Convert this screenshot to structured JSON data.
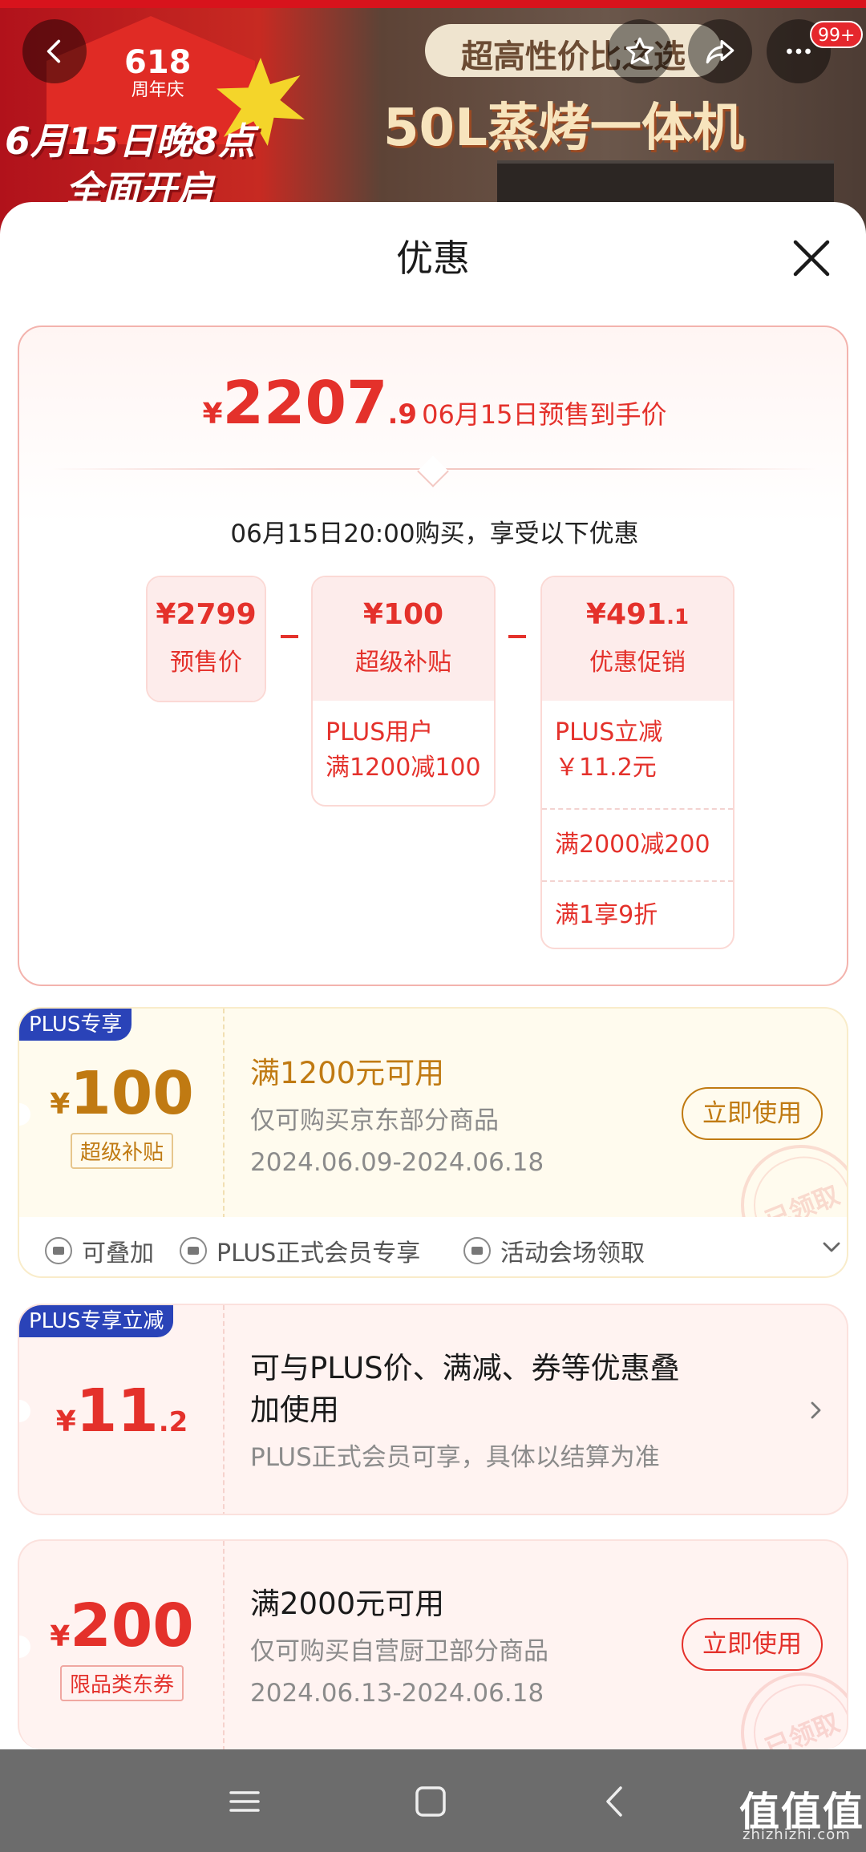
{
  "banner": {
    "logo_number": "618",
    "logo_sub": "周年庆",
    "promo_line1": "6月15日晚8点",
    "promo_line2": "全面开启",
    "pill_text": "超高性价比之选",
    "product_title": "50L蒸烤一体机",
    "badge_count": "99+"
  },
  "sheet": {
    "title": "优惠"
  },
  "summary": {
    "currency": "¥",
    "price_int": "2207",
    "price_dec": ".9",
    "price_label": "06月15日预售到手价",
    "buy_note": "06月15日20:00购买，享受以下优惠",
    "presale": {
      "amount": "¥2799",
      "name": "预售价"
    },
    "subsidy": {
      "amount": "¥100",
      "name": "超级补贴",
      "rows": [
        "PLUS用户",
        "满1200减100"
      ]
    },
    "promo": {
      "amount_int": "¥491",
      "amount_dec": ".1",
      "name": "优惠促销",
      "rows": [
        "PLUS立减",
        "￥11.2元",
        "满2000减200",
        "满1享9折"
      ]
    }
  },
  "coupons": [
    {
      "tag": "PLUS专享",
      "currency": "¥",
      "amount": "100",
      "label": "超级补贴",
      "title": "满1200元可用",
      "desc": "仅可购买京东部分商品",
      "date": "2024.06.09-2024.06.18",
      "button": "立即使用",
      "stamp": "已领取",
      "features": [
        "可叠加",
        "PLUS正式会员专享",
        "活动会场领取"
      ]
    },
    {
      "tag": "PLUS专享立减",
      "currency": "¥",
      "amount": "11",
      "amount_dec": ".2",
      "title_line1": "可与PLUS价、满减、券等优惠叠",
      "title_line2": "加使用",
      "desc": "PLUS正式会员可享，具体以结算为准"
    },
    {
      "currency": "¥",
      "amount": "200",
      "label": "限品类东券",
      "title": "满2000元可用",
      "desc": "仅可购买自营厨卫部分商品",
      "date": "2024.06.13-2024.06.18",
      "button": "立即使用",
      "stamp": "已领取"
    }
  ],
  "watermark": {
    "main": "值值值",
    "sub": "zhizhizhi.com"
  },
  "colors": {
    "accent_red": "#e4312b",
    "plus_blue": "#2a43b8",
    "gold": "#c07a12"
  }
}
